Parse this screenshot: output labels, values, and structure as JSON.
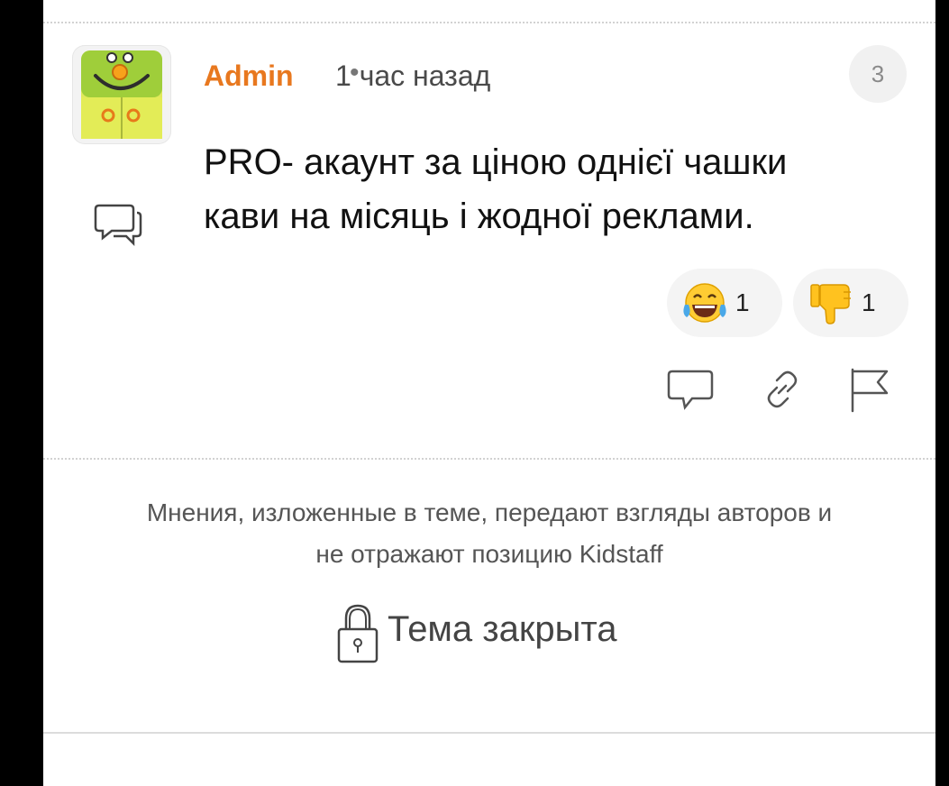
{
  "post": {
    "author": "Admin",
    "separator": "•",
    "time": "1 час назад",
    "number": "3",
    "message": "PRO- акаунт за ціною однієї чашки кави на місяць і жодної реклами.",
    "author_color": "#e8781f"
  },
  "reactions": [
    {
      "icon": "laughing-tears-emoji",
      "count": "1"
    },
    {
      "icon": "thumbs-down-emoji",
      "count": "1"
    }
  ],
  "actions": [
    "reply-icon",
    "link-icon",
    "flag-icon"
  ],
  "footer": {
    "disclaimer_line1": "Мнения, изложенные в теме, передают взгляды авторов и",
    "disclaimer_line2": "не отражают позицию Kidstaff",
    "closed_label": "Тема закрыта"
  }
}
